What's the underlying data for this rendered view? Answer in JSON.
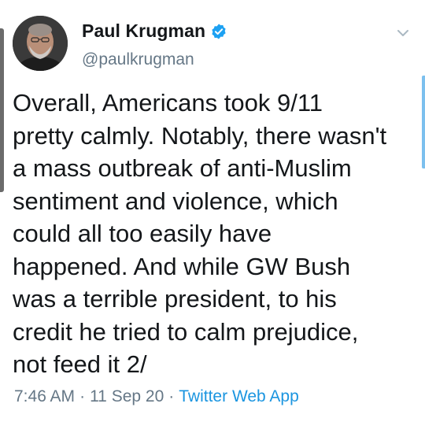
{
  "author": {
    "display_name": "Paul Krugman",
    "handle": "@paulkrugman",
    "verified": true
  },
  "tweet": {
    "text": "Overall, Americans took 9/11\npretty calmly. Notably, there wasn't\na mass outbreak of anti-Muslim\nsentiment and violence, which\ncould all too easily have\nhappened. And while GW Bush\nwas a terrible president, to his\ncredit he tried to calm prejudice,\nnot feed it 2/"
  },
  "meta": {
    "time": "7:46 AM",
    "date": "11 Sep 20",
    "source": "Twitter Web App",
    "separator": "·"
  },
  "icons": {
    "verified": "verified-badge-icon",
    "menu": "chevron-down-icon"
  },
  "colors": {
    "verified_blue": "#1da1f2",
    "link_blue": "#1b95e0",
    "text": "#14171a",
    "secondary": "#657786"
  }
}
